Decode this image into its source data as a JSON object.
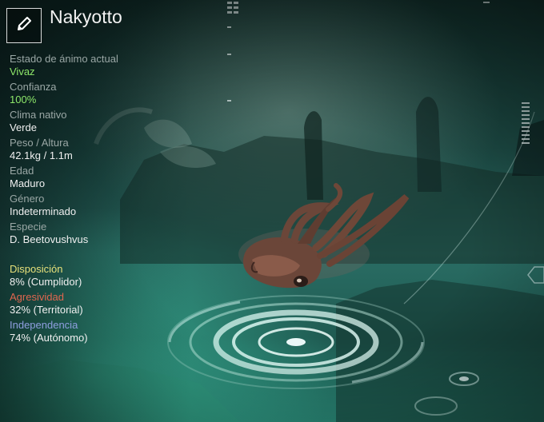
{
  "creature": {
    "name": "Nakyotto"
  },
  "stats": [
    {
      "label": "Estado de ánimo actual",
      "value": "Vivaz"
    },
    {
      "label": "Confianza",
      "value": "100%"
    },
    {
      "label": "Clima nativo",
      "value": "Verde"
    },
    {
      "label": "Peso / Altura",
      "value": "42.1kg / 1.1m"
    },
    {
      "label": "Edad",
      "value": "Maduro"
    },
    {
      "label": "Género",
      "value": "Indeterminado"
    },
    {
      "label": "Especie",
      "value": "D. Beetovushvus"
    }
  ],
  "traits": [
    {
      "label": "Disposición",
      "value": "8% (Cumplidor)"
    },
    {
      "label": "Agresividad",
      "value": "32% (Territorial)"
    },
    {
      "label": "Independencia",
      "value": "74% (Autónomo)"
    }
  ],
  "colors": {
    "positive": "#8ee86a",
    "disposition": "#e6e07a",
    "aggression": "#e0664f",
    "independence": "#8f9fe0"
  },
  "icons": {
    "edit": "pencil-icon"
  }
}
